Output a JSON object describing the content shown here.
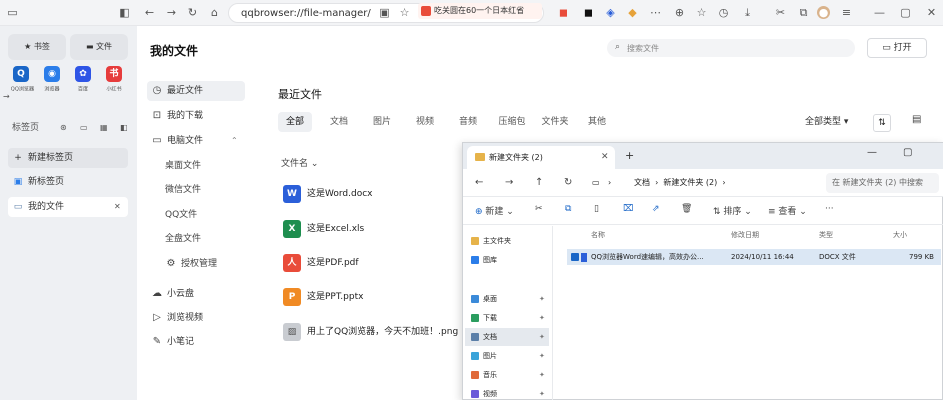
{
  "browser": {
    "address": "qqbrowser://file-manager/",
    "tab_chip_text": "吃关圆在60一个日本红省",
    "colors": {
      "accent": "#1a66c7",
      "sidebar_bg": "#eef0f3",
      "toolbar_bg": "#f3f4f6"
    }
  },
  "sidebar": {
    "bookmarks_label": "书签",
    "files_label": "文件",
    "quick_apps": [
      {
        "label": "QQ浏览器",
        "icon": "qq-icon",
        "color": "#1a66c7"
      },
      {
        "label": "浏览器",
        "icon": "browser-icon",
        "color": "#2b7de9"
      },
      {
        "label": "百度",
        "icon": "baidu-icon",
        "color": "#2e55e6"
      },
      {
        "label": "小红书",
        "icon": "xiaohongshu-icon",
        "color": "#e63c3c"
      }
    ],
    "tabs_section": "标签页",
    "new_tab": "新建标签页",
    "new_tab_page": "新标签页",
    "my_files": "我的文件"
  },
  "main": {
    "title": "我的文件",
    "search_placeholder": "搜索文件",
    "open_button": "打开",
    "nav": [
      {
        "label": "最近文件",
        "icon": "clock-icon"
      },
      {
        "label": "我的下载",
        "icon": "download-icon"
      },
      {
        "label": "电脑文件",
        "icon": "computer-icon"
      },
      {
        "label": "桌面文件",
        "icon": ""
      },
      {
        "label": "微信文件",
        "icon": ""
      },
      {
        "label": "QQ文件",
        "icon": ""
      },
      {
        "label": "全盘文件",
        "icon": ""
      },
      {
        "label": "授权管理",
        "icon": "gear-icon"
      },
      {
        "label": "小云盘",
        "icon": "cloud-icon"
      },
      {
        "label": "浏览视频",
        "icon": "video-icon"
      },
      {
        "label": "小笔记",
        "icon": "note-icon"
      }
    ],
    "content_title": "最近文件",
    "filter_tabs": [
      "全部",
      "文档",
      "图片",
      "视频",
      "音频",
      "压缩包",
      "文件夹",
      "其他"
    ],
    "sort_label": "全部类型",
    "file_section_label": "文件名",
    "files": [
      {
        "name": "这是Word.docx",
        "badge": "W",
        "color": "#2b5fd9"
      },
      {
        "name": "这是Excel.xls",
        "badge": "X",
        "color": "#1e8e4f"
      },
      {
        "name": "这是PDF.pdf",
        "badge": "人",
        "color": "#e94c3a"
      },
      {
        "name": "这是PPT.pptx",
        "badge": "P",
        "color": "#f08a24"
      },
      {
        "name": "用上了QQ浏览器，今天不加班！.png",
        "badge": "",
        "color": "#c9ccd1"
      }
    ]
  },
  "explorer": {
    "tab_title": "新建文件夹 (2)",
    "path_parts": [
      "文档",
      "新建文件夹 (2)"
    ],
    "search_placeholder": "在 新建文件夹 (2) 中搜索",
    "toolbar": {
      "new": "新建",
      "sort": "排序",
      "view": "查看",
      "more": "···"
    },
    "side_items": [
      {
        "label": "主文件夹",
        "color": "#e6b34a",
        "pinned": false
      },
      {
        "label": "图库",
        "color": "#2b7de9",
        "pinned": false
      },
      {
        "label": "桌面",
        "color": "#3b8ad9",
        "pinned": true
      },
      {
        "label": "下载",
        "color": "#2b9d5f",
        "pinned": true
      },
      {
        "label": "文档",
        "color": "#5b7fa8",
        "pinned": true
      },
      {
        "label": "图片",
        "color": "#3aa3d9",
        "pinned": true
      },
      {
        "label": "音乐",
        "color": "#e06a3a",
        "pinned": true
      },
      {
        "label": "视频",
        "color": "#6b5bd9",
        "pinned": true
      }
    ],
    "headers": {
      "name": "名称",
      "date": "修改日期",
      "type": "类型",
      "size": "大小"
    },
    "rows": [
      {
        "name": "QQ浏览器Word速编辑，高效办公...",
        "date": "2024/10/11 16:44",
        "type": "DOCX 文件",
        "size": "799 KB"
      }
    ]
  }
}
